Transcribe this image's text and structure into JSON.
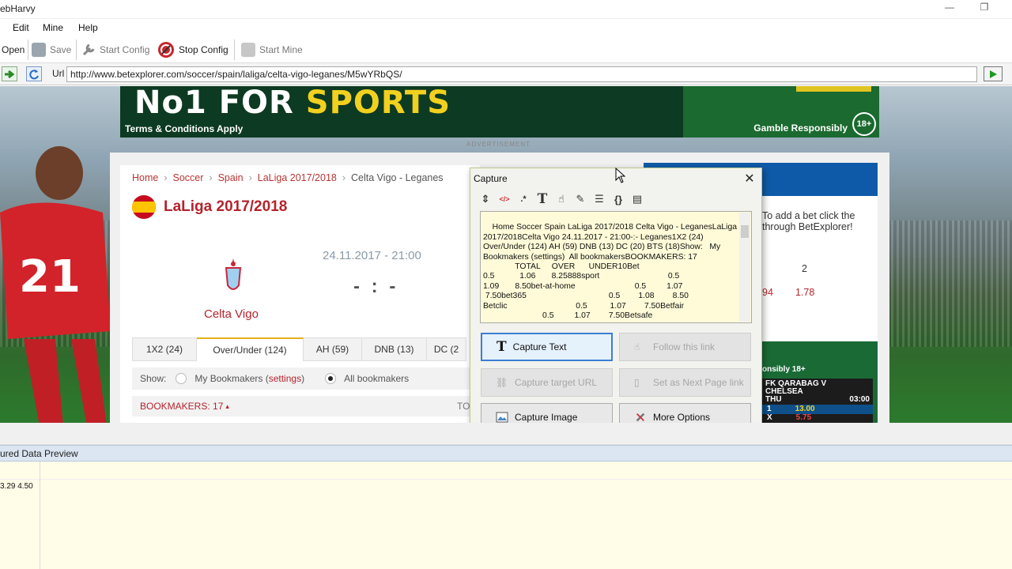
{
  "window": {
    "title": "ebHarvy"
  },
  "menu": {
    "items": [
      "Edit",
      "Mine",
      "Help"
    ]
  },
  "toolbar": {
    "open": "Open",
    "save": "Save",
    "start_config": "Start Config",
    "stop_config": "Stop Config",
    "start_mine": "Start Mine"
  },
  "urlbar": {
    "label": "Url",
    "value": "http://www.betexplorer.com/soccer/spain/laliga/celta-vigo-leganes/M5wYRbQS/"
  },
  "page": {
    "banner": {
      "headline_a": "No1 FOR ",
      "headline_b": "SPORTS",
      "terms": "Terms & Conditions Apply",
      "gamble": "Gamble Responsibly",
      "age": "18+"
    },
    "advertisement": "ADVERTISEMENT",
    "breadcrumb": [
      "Home",
      "Soccer",
      "Spain",
      "LaLiga 2017/2018",
      "Celta Vigo - Leganes"
    ],
    "league_title": "LaLiga 2017/2018",
    "home_team": "Celta Vigo",
    "match_date": "24.11.2017 - 21:00",
    "score": "- : -",
    "tabs": [
      "1X2 (24)",
      "Over/Under (124)",
      "AH (59)",
      "DNB (13)",
      "DC (2"
    ],
    "active_tab": "Over/Under (124)",
    "show": {
      "label": "Show:",
      "my_bookmakers": "My Bookmakers (",
      "settings": "settings",
      "close_paren": ")",
      "all_bookmakers": "All bookmakers"
    },
    "bookmakers": {
      "label": "BOOKMAKERS: 17",
      "arrow": "▴",
      "to": "TO"
    },
    "side": {
      "hint_1": "To add a bet click the",
      "hint_2": "through BetExplorer!",
      "odd_header": "2",
      "odd_left": "94",
      "odd_value": "1.78",
      "responsibly": "onsibly 18+",
      "fixture_1": "FK QARABAG V",
      "fixture_2": "CHELSEA",
      "day": "THU",
      "time": "03:00",
      "sel": "1",
      "odd": "13.00",
      "x": "X",
      "odd_x": "5.75"
    }
  },
  "capture": {
    "title": "Capture",
    "captured_text": "Home Soccer Spain LaLiga 2017/2018 Celta Vigo - LeganesLaLiga\n2017/2018Celta Vigo 24.11.2017 - 21:00-:- Leganes1X2 (24)\nOver/Under (124) AH (59) DNB (13) DC (20) BTS (18)Show:   My\nBookmakers (settings)  All bookmakersBOOKMAKERS: 17\n              TOTAL     OVER      UNDER10Bet\n0.5           1.06       8.25888sport                              0.5\n1.09       8.50bet-at-home                          0.5         1.07\n 7.50bet365                                    0.5        1.08        8.50\nBetclic                              0.5          1.07        7.50Betfair\n                          0.5         1.07        7.50Betsafe",
    "buttons": {
      "capture_text": "Capture Text",
      "follow_link": "Follow this link",
      "capture_url": "Capture target URL",
      "next_page": "Set as Next Page link",
      "capture_image": "Capture Image",
      "more_options": "More Options"
    }
  },
  "preview": {
    "header": "ured Data Preview",
    "first_cell": "3.29 4.50"
  },
  "colors": {
    "accent_red": "#b4232c",
    "capture_bg": "#fffbd8",
    "preview_bg": "#fffce8",
    "primary_btn_border": "#3b7fd1"
  }
}
